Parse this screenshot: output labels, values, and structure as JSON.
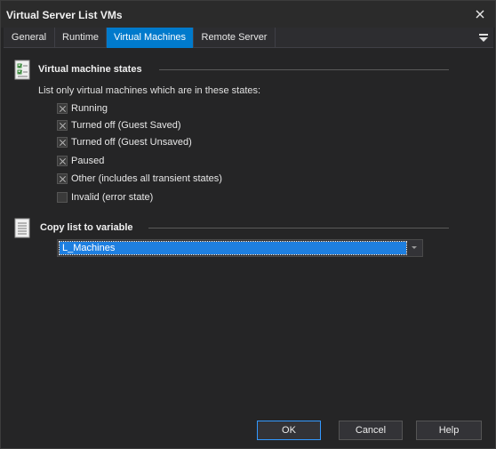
{
  "window": {
    "title": "Virtual Server List VMs"
  },
  "tabs": [
    {
      "label": "General"
    },
    {
      "label": "Runtime"
    },
    {
      "label": "Virtual Machines"
    },
    {
      "label": "Remote Server"
    }
  ],
  "states_section": {
    "title": "Virtual machine states",
    "description": "List only virtual machines which are in these states:",
    "options": [
      {
        "label": "Running",
        "checked": true
      },
      {
        "label": "Turned off (Guest Saved)",
        "checked": true
      },
      {
        "label": "Turned off (Guest Unsaved)",
        "checked": true
      },
      {
        "label": "Paused",
        "checked": true
      },
      {
        "label": "Other (includes all transient states)",
        "checked": true
      },
      {
        "label": "Invalid (error state)",
        "checked": false
      }
    ]
  },
  "variable_section": {
    "title": "Copy list to variable",
    "selected": "L_Machines"
  },
  "buttons": {
    "ok": "OK",
    "cancel": "Cancel",
    "help": "Help"
  },
  "colors": {
    "accent": "#007acc",
    "selection": "#1e7fe0",
    "background": "#252526"
  }
}
